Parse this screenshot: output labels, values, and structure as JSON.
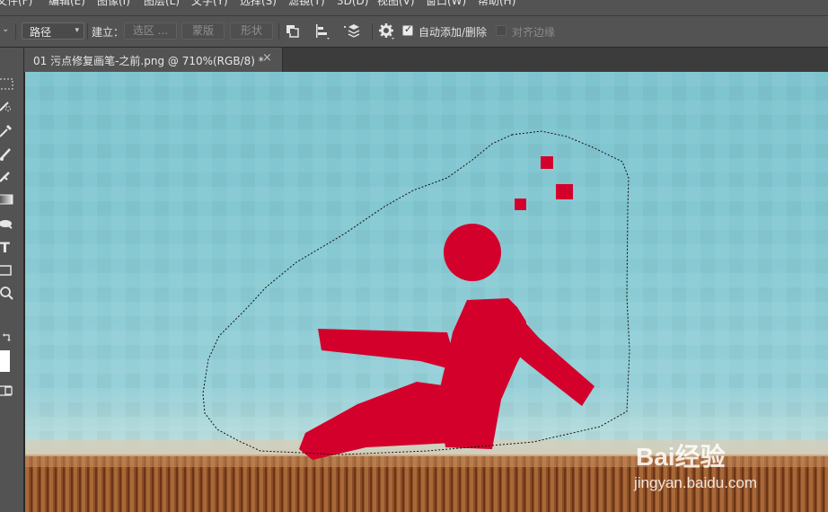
{
  "menu": {
    "items": [
      "文件(F)",
      "编辑(E)",
      "图像(I)",
      "图层(L)",
      "文字(Y)",
      "选择(S)",
      "滤镜(T)",
      "3D(D)",
      "视图(V)",
      "窗口(W)",
      "帮助(H)"
    ]
  },
  "options": {
    "path_mode": "路径",
    "make_label": "建立：",
    "selection_btn": "选区 ...",
    "mask_btn": "蒙版",
    "shape_btn": "形状",
    "auto_add_delete": "自动添加/删除",
    "auto_add_delete_checked": true,
    "align_edges": "对齐边缘",
    "align_edges_checked": false
  },
  "document": {
    "tab_title": "01 污点修复画笔-之前.png @ 710%(RGB/8) *",
    "close": "×"
  },
  "watermark": {
    "logo": "Bai经验",
    "url": "jingyan.baidu.com"
  },
  "colors": {
    "accent_red": "#d4002c",
    "panel_bg": "#535353"
  }
}
